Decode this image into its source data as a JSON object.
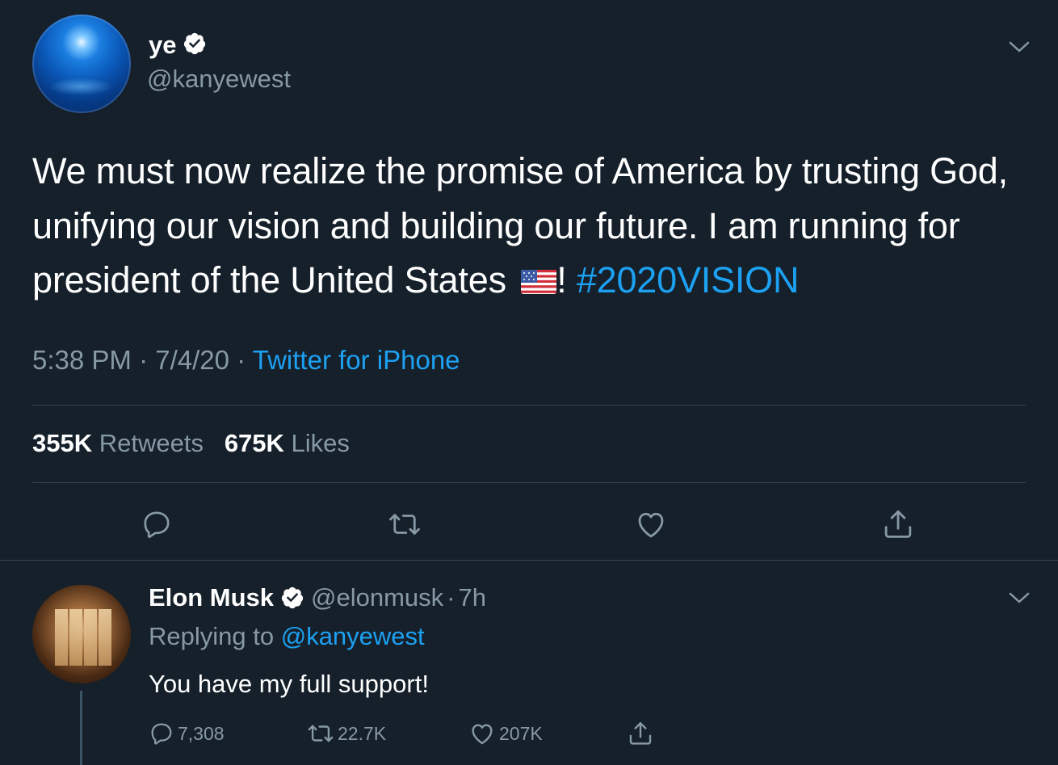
{
  "tweet": {
    "author_name": "ye",
    "author_handle": "@kanyewest",
    "text_main": "We must now realize the promise of America by trusting God, unifying our vision and building our future. I am running for president of the United States",
    "text_after_flag": "!",
    "hashtag": "#2020VISION",
    "time": "5:38 PM",
    "date": "7/4/20",
    "separator": "·",
    "source": "Twitter for iPhone",
    "retweets_count": "355K",
    "retweets_label": "Retweets",
    "likes_count": "675K",
    "likes_label": "Likes",
    "icons": [
      "avatar",
      "verified-badge-icon",
      "chevron-down-icon",
      "us-flag-emoji",
      "reply-icon",
      "retweet-icon",
      "like-icon",
      "share-icon"
    ]
  },
  "reply": {
    "author_name": "Elon Musk",
    "author_handle": "@elonmusk",
    "separator": "·",
    "age": "7h",
    "replying_prefix": "Replying to",
    "replying_to": "@kanyewest",
    "text": "You have my full support!",
    "reply_count": "7,308",
    "retweet_count": "22.7K",
    "like_count": "207K"
  },
  "colors": {
    "background": "#15202b",
    "text_primary": "#ffffff",
    "text_secondary": "#8899a6",
    "accent": "#1da1f2",
    "divider": "#38444d"
  }
}
